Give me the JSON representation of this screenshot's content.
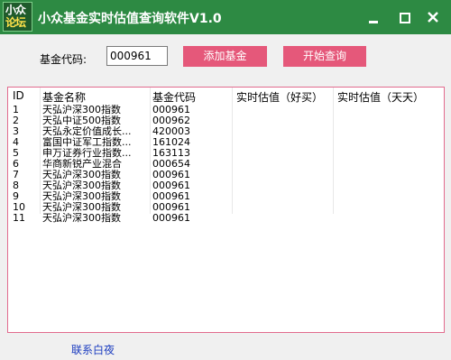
{
  "window": {
    "title": "小众基金实时估值查询软件V1.0",
    "logo_line1": "小众",
    "logo_line2": "论坛",
    "controls": [
      "minimize",
      "maximize",
      "close"
    ]
  },
  "form": {
    "code_label": "基金代码:",
    "code_value": "000961",
    "add_button": "添加基金",
    "query_button": "开始查询"
  },
  "table": {
    "headers": [
      "ID",
      "基金名称",
      "基金代码",
      "实时估值（好买）",
      "实时估值（天天）"
    ],
    "rows": [
      {
        "id": "1",
        "name": "天弘沪深300指数",
        "code": "000961"
      },
      {
        "id": "2",
        "name": "天弘中证500指数",
        "code": "000962"
      },
      {
        "id": "3",
        "name": "天弘永定价值成长...",
        "code": "420003"
      },
      {
        "id": "4",
        "name": "富国中证军工指数...",
        "code": "161024"
      },
      {
        "id": "5",
        "name": "申万证券行业指数...",
        "code": "163113"
      },
      {
        "id": "6",
        "name": "华商新锐产业混合",
        "code": "000654"
      },
      {
        "id": "7",
        "name": "天弘沪深300指数",
        "code": "000961"
      },
      {
        "id": "8",
        "name": "天弘沪深300指数",
        "code": "000961"
      },
      {
        "id": "9",
        "name": "天弘沪深300指数",
        "code": "000961"
      },
      {
        "id": "10",
        "name": "天弘沪深300指数",
        "code": "000961"
      },
      {
        "id": "11",
        "name": "天弘沪深300指数",
        "code": "000961"
      }
    ]
  },
  "footer": {
    "contact_link": "联系白夜"
  },
  "colors": {
    "titlebar": "#2d8a43",
    "button": "#e5587a",
    "grid_border": "#e26b8e",
    "link": "#1a3bbf"
  }
}
